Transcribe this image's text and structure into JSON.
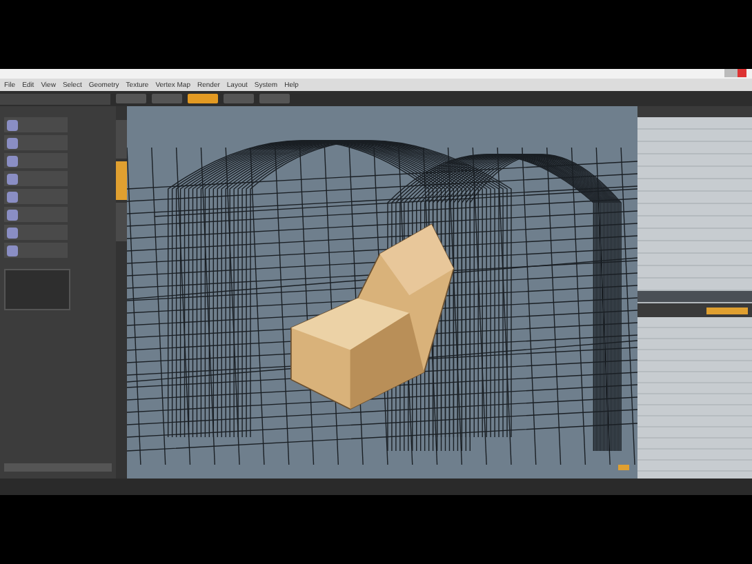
{
  "menu": [
    "File",
    "Edit",
    "View",
    "Select",
    "Geometry",
    "Texture",
    "Vertex Map",
    "Render",
    "Layout",
    "System",
    "Help"
  ],
  "modes": [
    {
      "selected": false
    },
    {
      "selected": false
    },
    {
      "selected": true
    },
    {
      "selected": false
    },
    {
      "selected": false
    }
  ],
  "tools": [
    {
      "selected": false
    },
    {
      "selected": false
    },
    {
      "selected": false
    },
    {
      "selected": false
    },
    {
      "selected": false
    },
    {
      "selected": false
    },
    {
      "selected": false
    },
    {
      "selected": false
    }
  ],
  "side_tabs": [
    {
      "selected": false
    },
    {
      "selected": true
    },
    {
      "selected": false
    }
  ],
  "items": [
    {
      "selected": false
    },
    {
      "selected": false
    },
    {
      "selected": false
    },
    {
      "selected": false
    },
    {
      "selected": false
    },
    {
      "selected": false
    },
    {
      "selected": false
    },
    {
      "selected": false
    },
    {
      "selected": false
    },
    {
      "selected": false
    },
    {
      "selected": false
    },
    {
      "selected": false
    },
    {
      "selected": false
    },
    {
      "selected": false
    },
    {
      "selected": true
    }
  ]
}
